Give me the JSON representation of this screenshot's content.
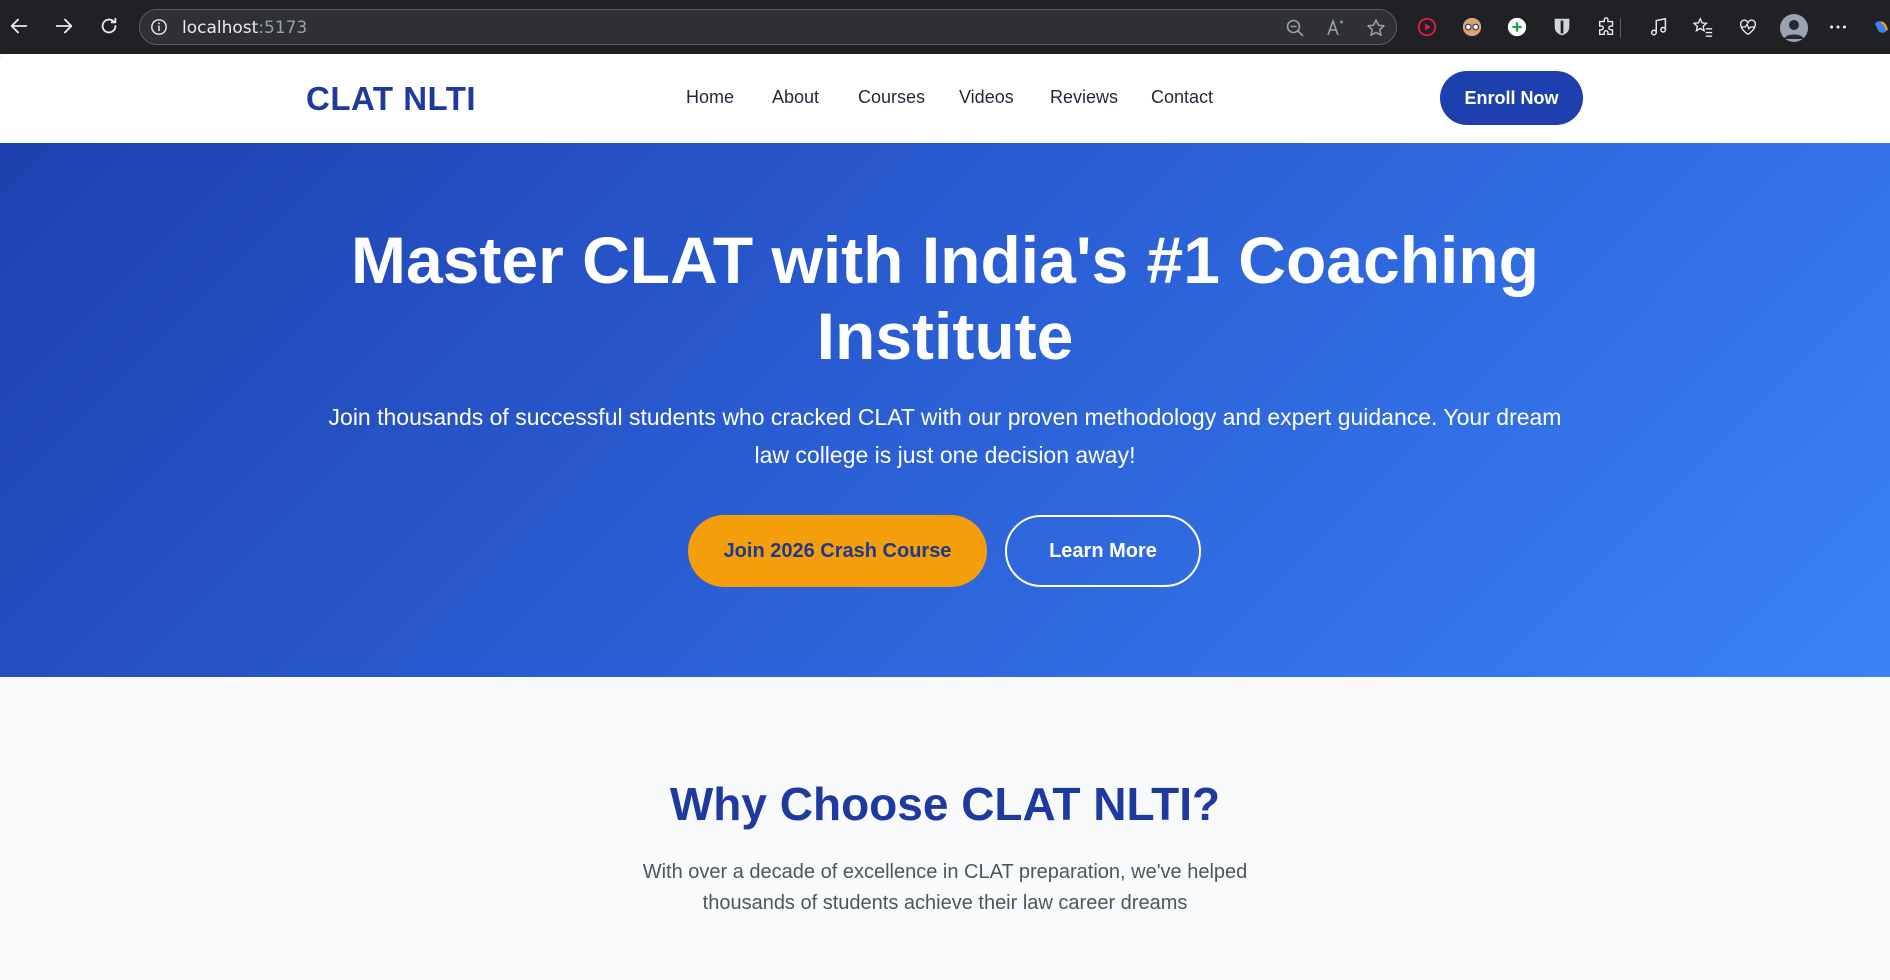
{
  "browser": {
    "address_host": "localhost",
    "address_port": ":5173",
    "icons": [
      "back-icon",
      "forward-icon",
      "reload-icon",
      "site-info-icon",
      "zoom-out-icon",
      "read-aloud-icon",
      "favorite-star-icon",
      "extension-red-icon",
      "extension-glasses-icon",
      "extension-plus-icon",
      "extension-shield-icon",
      "extensions-puzzle-icon",
      "media-icon",
      "favorites-icon",
      "browser-essentials-icon",
      "profile-avatar",
      "more-menu-icon",
      "copilot-icon"
    ]
  },
  "header": {
    "logo": "CLAT NLTI",
    "nav": [
      {
        "label": "Home"
      },
      {
        "label": "About"
      },
      {
        "label": "Courses"
      },
      {
        "label": "Videos"
      },
      {
        "label": "Reviews"
      },
      {
        "label": "Contact"
      }
    ],
    "cta_label": "Enroll Now"
  },
  "hero": {
    "title_line1": "Master CLAT with India's #1 Coaching",
    "title_line2": "Institute",
    "subtitle_line1": "Join thousands of successful students who cracked CLAT with our proven methodology and expert guidance. Your dream",
    "subtitle_line2": "law college is just one decision away!",
    "primary_button": "Join 2026 Crash Course",
    "secondary_button": "Learn More"
  },
  "why": {
    "title": "Why Choose CLAT NLTI?",
    "subtitle_line1": "With over a decade of excellence in CLAT preparation, we've helped",
    "subtitle_line2": "thousands of students achieve their law career dreams"
  },
  "colors": {
    "brand_blue": "#1e40af",
    "accent_orange": "#f59e0b",
    "hero_gradient_start": "#1e40af",
    "hero_gradient_end": "#3b82f6"
  }
}
